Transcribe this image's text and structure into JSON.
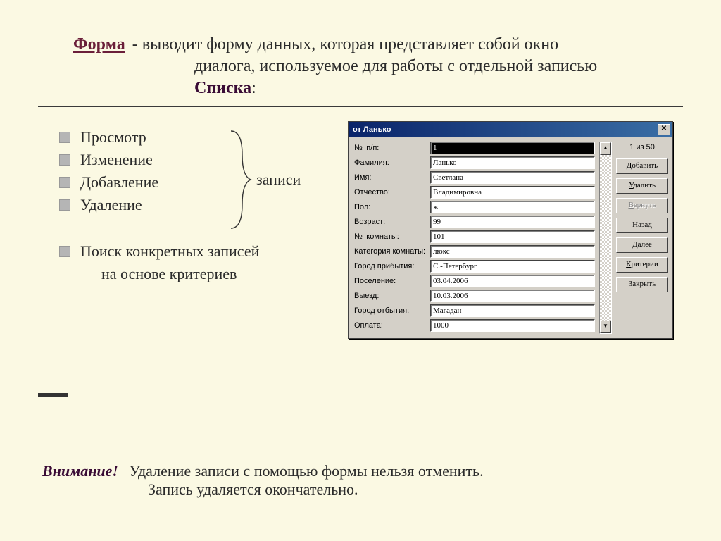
{
  "title": {
    "word": "Форма",
    "rest": "- выводит форму данных, которая представляет собой окно",
    "line2": "диалога, используемое для работы с отдельной записью",
    "list_word": "Списка",
    "colon": ":"
  },
  "bullets_a": [
    "Просмотр",
    "Изменение",
    "Добавление",
    "Удаление"
  ],
  "brace_label": "записи",
  "bullets_b": [
    "Поиск конкретных записей",
    "на основе критериев"
  ],
  "dialog": {
    "title": "от Ланько",
    "counter": "1 из 50",
    "fields": [
      {
        "label": "№ п/п:",
        "value": "1",
        "dark": true
      },
      {
        "label": "Фамилия:",
        "value": "Ланько"
      },
      {
        "label": "Имя:",
        "value": "Светлана"
      },
      {
        "label": "Отчество:",
        "value": "Владимировна"
      },
      {
        "label": "Пол:",
        "value": "ж"
      },
      {
        "label": "Возраст:",
        "value": "99"
      },
      {
        "label": "№ комнаты:",
        "value": "101"
      },
      {
        "label": "Категория комнаты:",
        "value": "люкс"
      },
      {
        "label": "Город прибытия:",
        "value": "С.-Петербург"
      },
      {
        "label": "Поселение:",
        "value": "03.04.2006"
      },
      {
        "label": "Выезд:",
        "value": "10.03.2006"
      },
      {
        "label": "Город отбытия:",
        "value": "Магадан"
      },
      {
        "label": "Оплата:",
        "value": "1000"
      }
    ],
    "buttons": [
      {
        "text": "Добавить",
        "u": 0,
        "disabled": false
      },
      {
        "text": "Удалить",
        "u": 0,
        "disabled": false
      },
      {
        "text": "Вернуть",
        "u": 0,
        "disabled": true
      },
      {
        "text": "Назад",
        "u": 0,
        "disabled": false
      },
      {
        "text": "Далее",
        "u": 0,
        "disabled": false
      },
      {
        "text": "Критерии",
        "u": 0,
        "disabled": false
      },
      {
        "text": "Закрыть",
        "u": 0,
        "disabled": false
      }
    ]
  },
  "footer": {
    "warn": "Внимание!",
    "line1": "Удаление записи с помощью формы нельзя отменить.",
    "line2": "Запись удаляется окончательно."
  }
}
